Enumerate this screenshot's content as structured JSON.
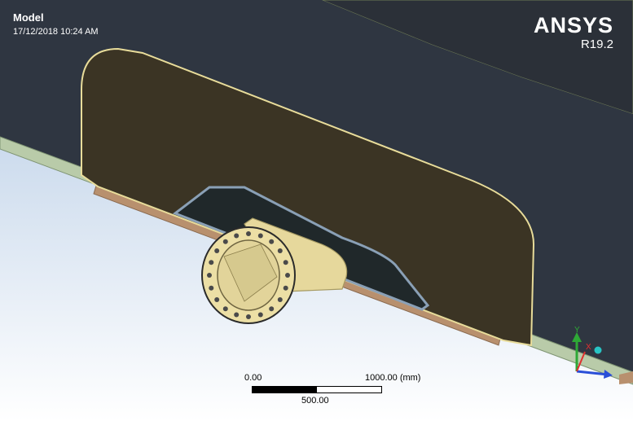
{
  "viewport": {
    "title": "Model",
    "timestamp": "17/12/2018 10:24 AM"
  },
  "brand": {
    "name": "ANSYS",
    "version": "R19.2"
  },
  "scale_bar": {
    "label_start": "0.00",
    "label_end": "1000.00 (mm)",
    "label_mid": "500.00"
  },
  "triad": {
    "y_label": "Y",
    "x_label": "X",
    "y_color": "#2ea836",
    "x_color": "#e03030",
    "z_color": "#2a4fd8"
  },
  "colors": {
    "background_dark": "#2f3641",
    "background_light": "#c9d9ec",
    "plate_fill": "#3b3424",
    "plate_edge": "#e8dc9a",
    "flange_fill": "#ecdfa5"
  }
}
